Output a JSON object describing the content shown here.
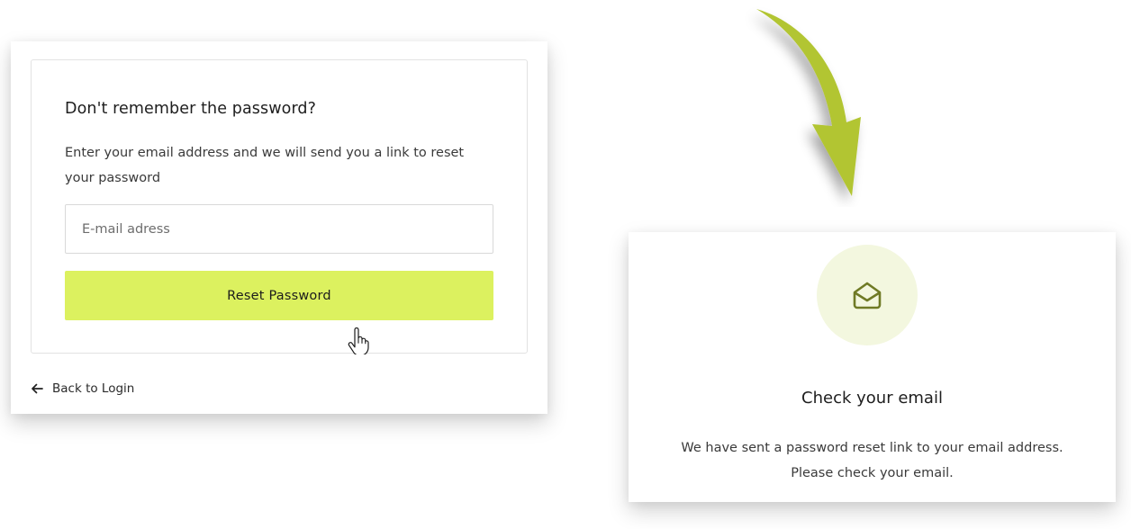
{
  "forgot": {
    "title": "Don't remember the password?",
    "description": "Enter your email address and we will send you a link to reset your password",
    "email_placeholder": "E-mail adress",
    "reset_label": "Reset Password",
    "back_label": "Back to Login"
  },
  "confirm": {
    "title": "Check your email",
    "line1": "We have sent a password reset link to your email address.",
    "line2": "Please check your email."
  },
  "icons": {
    "arrow": "curved-arrow-icon",
    "cursor": "hand-pointer-icon",
    "back": "arrow-left-icon",
    "mail": "envelope-open-icon"
  },
  "colors": {
    "accent": "#dcf15f",
    "arrow": "#b2c530",
    "mail_circle": "#f3f7df",
    "mail_icon": "#6f7a25"
  }
}
